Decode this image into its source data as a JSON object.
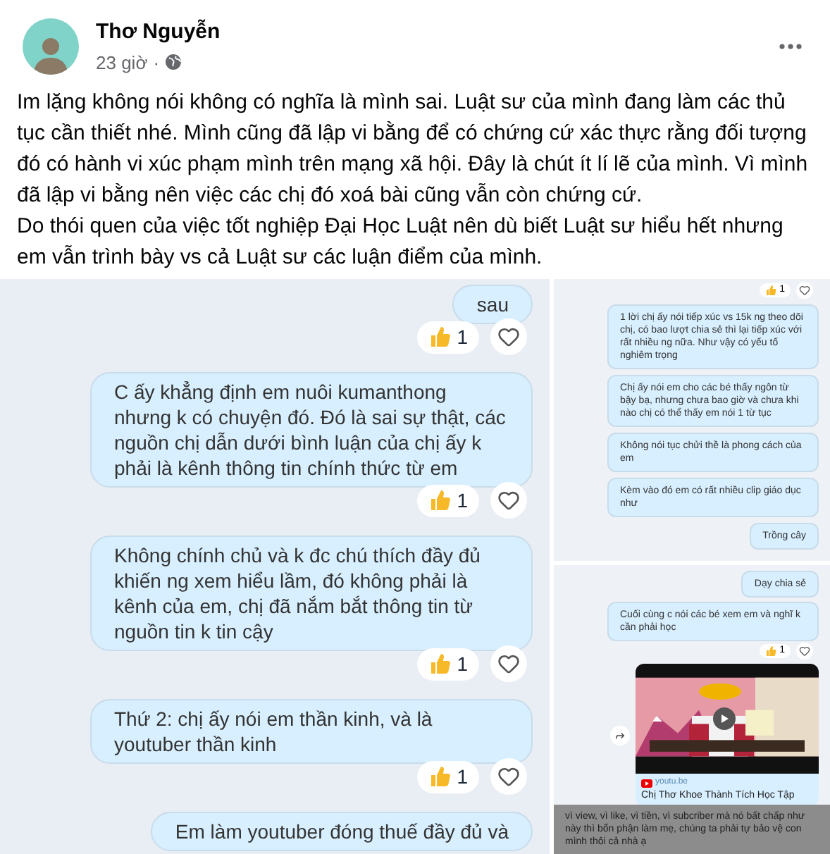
{
  "post": {
    "author": "Thơ Nguyễn",
    "time": "23 giờ",
    "separator": "·",
    "paragraphs": [
      "Im lặng không nói không có nghĩa là mình sai. Luật sư của mình đang làm các thủ tục cần thiết nhé. Mình cũng đã lập vi bằng để có chứng cứ xác thực rằng đối tượng đó có hành vi xúc phạm mình trên mạng xã hội. Đây là chút ít lí lẽ của mình. Vì mình đã lập vi bằng nên việc các chị đó xoá bài cũng vẫn còn chứng cứ.",
      "Do thói quen của việc tốt nghiệp Đại Học Luật nên dù biết Luật sư hiểu hết nhưng em vẫn trình bày vs cả Luật sư các luận điểm của mình."
    ]
  },
  "screenshots": [
    {
      "items": [
        {
          "kind": "bubble",
          "text": "sau"
        },
        {
          "kind": "reaction",
          "count": "1"
        },
        {
          "kind": "bubble",
          "text": "C ấy khẳng định em nuôi kumanthong nhưng k có chuyện đó. Đó là sai sự thật, các nguồn chị dẫn dưới bình luận của chị ấy k phải là kênh thông tin chính thức từ em"
        },
        {
          "kind": "reaction",
          "count": "1"
        },
        {
          "kind": "bubble",
          "text": "Không chính chủ và k đc chú thích đầy đủ khiến ng xem hiểu lầm, đó không phải là kênh của em, chị đã nắm bắt thông tin từ nguồn tin k tin cậy"
        },
        {
          "kind": "reaction",
          "count": "1"
        },
        {
          "kind": "bubble",
          "text": "Thứ 2: chị ấy nói em thần kinh, và là youtuber thần kinh"
        },
        {
          "kind": "reaction",
          "count": "1"
        },
        {
          "kind": "bubble",
          "text": "Em làm youtuber đóng thuế đầy đủ và"
        }
      ]
    },
    {
      "items": [
        {
          "kind": "reaction",
          "count": "1"
        },
        {
          "kind": "bubble",
          "text": "1 lời chị ấy nói tiếp xúc vs 15k ng theo dõi chị, có bao lượt chia sẻ thì lại tiếp xúc với rất nhiều ng nữa. Như vậy có yếu tố nghiêm trọng"
        },
        {
          "kind": "bubble",
          "text": "Chị ấy nói em cho các bé thấy ngôn từ bậy bạ, nhưng chưa bao giờ và chưa khi nào chị có thể thấy em nói 1 từ tục"
        },
        {
          "kind": "bubble",
          "text": "Không nói tục chửi thề là phong cách của em"
        },
        {
          "kind": "bubble",
          "text": "Kèm vào đó em có rất nhiều clip giáo dục như"
        },
        {
          "kind": "bubble",
          "text": "Trồng cây"
        }
      ]
    },
    {
      "items": [
        {
          "kind": "bubble",
          "text": "Dạy chia sẻ"
        },
        {
          "kind": "bubble",
          "text": "Cuối cùng c nói các bé xem em và nghĩ k cần phải học"
        },
        {
          "kind": "reaction",
          "count": "1"
        },
        {
          "kind": "link-card",
          "source": "youtu.be",
          "title": "Chị Thơ Khoe Thành Tích Học Tập"
        }
      ],
      "caption": "vì view, vì like, vì tiền, vì subcriber mà nó bất chấp như này thì bổn phận làm mẹ, chúng ta phải tự bảo vệ con mình thôi cả nhà ạ"
    }
  ]
}
